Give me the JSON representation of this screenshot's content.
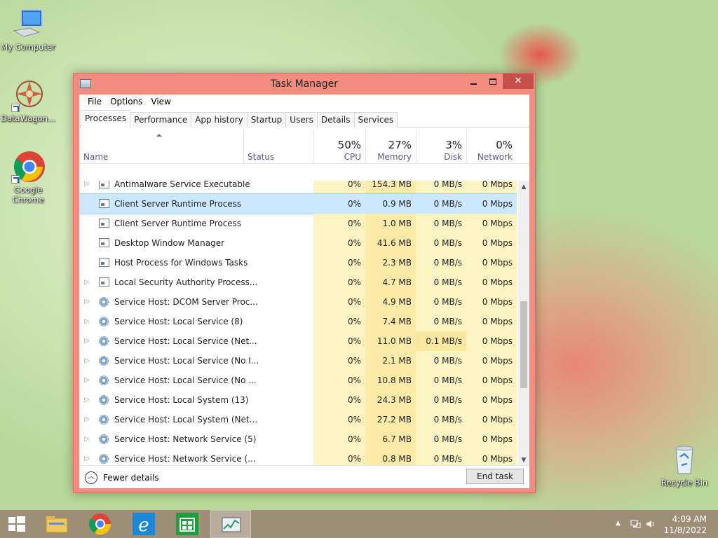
{
  "desktop": {
    "icons": [
      {
        "label": "My Computer"
      },
      {
        "label": "DataWagon..."
      },
      {
        "label": "Google Chrome"
      },
      {
        "label": "Recycle Bin"
      }
    ]
  },
  "window": {
    "title": "Task Manager",
    "menu": [
      "File",
      "Options",
      "View"
    ],
    "tabs": [
      "Processes",
      "Performance",
      "App history",
      "Startup",
      "Users",
      "Details",
      "Services"
    ],
    "active_tab": "Processes",
    "columns": {
      "name": "Name",
      "status": "Status",
      "cpu": {
        "pct": "50%",
        "label": "CPU"
      },
      "memory": {
        "pct": "27%",
        "label": "Memory"
      },
      "disk": {
        "pct": "3%",
        "label": "Disk"
      },
      "network": {
        "pct": "0%",
        "label": "Network"
      }
    },
    "rows": [
      {
        "name": "Antimalware Service Executable",
        "cpu": "0%",
        "mem": "154.3 MB",
        "disk": "0 MB/s",
        "net": "0 Mbps",
        "icon": "app",
        "expand": true
      },
      {
        "name": "Client Server Runtime Process",
        "cpu": "0%",
        "mem": "0.9 MB",
        "disk": "0 MB/s",
        "net": "0 Mbps",
        "icon": "app",
        "expand": false
      },
      {
        "name": "Client Server Runtime Process",
        "cpu": "0%",
        "mem": "1.0 MB",
        "disk": "0 MB/s",
        "net": "0 Mbps",
        "icon": "app",
        "expand": false
      },
      {
        "name": "Desktop Window Manager",
        "cpu": "0%",
        "mem": "41.6 MB",
        "disk": "0 MB/s",
        "net": "0 Mbps",
        "icon": "app",
        "expand": false
      },
      {
        "name": "Host Process for Windows Tasks",
        "cpu": "0%",
        "mem": "2.3 MB",
        "disk": "0 MB/s",
        "net": "0 Mbps",
        "icon": "app",
        "expand": false
      },
      {
        "name": "Local Security Authority Process...",
        "cpu": "0%",
        "mem": "4.7 MB",
        "disk": "0 MB/s",
        "net": "0 Mbps",
        "icon": "app",
        "expand": true
      },
      {
        "name": "Service Host: DCOM Server Proc...",
        "cpu": "0%",
        "mem": "4.9 MB",
        "disk": "0 MB/s",
        "net": "0 Mbps",
        "icon": "gear",
        "expand": true
      },
      {
        "name": "Service Host: Local Service (8)",
        "cpu": "0%",
        "mem": "7.4 MB",
        "disk": "0 MB/s",
        "net": "0 Mbps",
        "icon": "gear",
        "expand": true
      },
      {
        "name": "Service Host: Local Service (Net...",
        "cpu": "0%",
        "mem": "11.0 MB",
        "disk": "0.1 MB/s",
        "net": "0 Mbps",
        "icon": "gear",
        "expand": true
      },
      {
        "name": "Service Host: Local Service (No I...",
        "cpu": "0%",
        "mem": "2.1 MB",
        "disk": "0 MB/s",
        "net": "0 Mbps",
        "icon": "gear",
        "expand": true
      },
      {
        "name": "Service Host: Local Service (No ...",
        "cpu": "0%",
        "mem": "10.8 MB",
        "disk": "0 MB/s",
        "net": "0 Mbps",
        "icon": "gear",
        "expand": true
      },
      {
        "name": "Service Host: Local System (13)",
        "cpu": "0%",
        "mem": "24.3 MB",
        "disk": "0 MB/s",
        "net": "0 Mbps",
        "icon": "gear",
        "expand": true
      },
      {
        "name": "Service Host: Local System (Net...",
        "cpu": "0%",
        "mem": "27.2 MB",
        "disk": "0 MB/s",
        "net": "0 Mbps",
        "icon": "gear",
        "expand": true
      },
      {
        "name": "Service Host: Network Service (5)",
        "cpu": "0%",
        "mem": "6.7 MB",
        "disk": "0 MB/s",
        "net": "0 Mbps",
        "icon": "gear",
        "expand": true
      },
      {
        "name": "Service Host: Network Service (...",
        "cpu": "0%",
        "mem": "0.8 MB",
        "disk": "0 MB/s",
        "net": "0 Mbps",
        "icon": "gear",
        "expand": true
      }
    ],
    "footer": {
      "fewer_details": "Fewer details",
      "end_task": "End task"
    }
  },
  "taskbar": {
    "time": "4:09 AM",
    "date": "11/8/2022"
  }
}
